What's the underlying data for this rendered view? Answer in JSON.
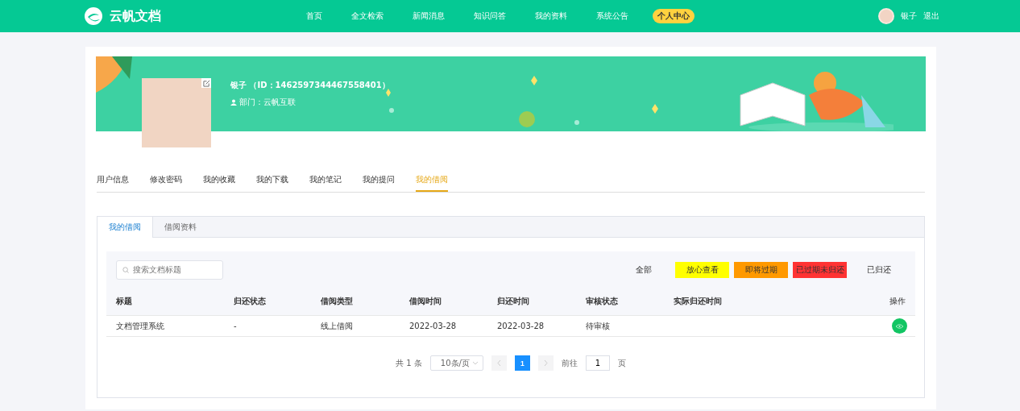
{
  "header": {
    "brand": "云帆文档",
    "nav": [
      {
        "label": "首页",
        "selected": false
      },
      {
        "label": "全文检索",
        "selected": false
      },
      {
        "label": "新闻消息",
        "selected": false
      },
      {
        "label": "知识问答",
        "selected": false
      },
      {
        "label": "我的资料",
        "selected": false
      },
      {
        "label": "系统公告",
        "selected": false
      },
      {
        "label": "个人中心",
        "selected": true
      }
    ],
    "user": "银子",
    "logout": "退出"
  },
  "profile": {
    "name": "银子 （ID：1462597344467558401）",
    "department": "部门：云帆互联"
  },
  "tabs": [
    {
      "label": "用户信息",
      "selected": false
    },
    {
      "label": "修改密码",
      "selected": false
    },
    {
      "label": "我的收藏",
      "selected": false
    },
    {
      "label": "我的下载",
      "selected": false
    },
    {
      "label": "我的笔记",
      "selected": false
    },
    {
      "label": "我的提问",
      "selected": false
    },
    {
      "label": "我的借阅",
      "selected": true
    }
  ],
  "subtabs": [
    {
      "label": "我的借阅",
      "selected": true
    },
    {
      "label": "借阅资料",
      "selected": false
    }
  ],
  "search": {
    "placeholder": "搜索文档标题"
  },
  "filters": [
    {
      "label": "全部"
    },
    {
      "label": "放心查看",
      "color": "#ffff00"
    },
    {
      "label": "即将过期",
      "color": "#ff9900"
    },
    {
      "label": "已过期未归还",
      "color": "#ff3333"
    },
    {
      "label": "已归还"
    }
  ],
  "table": {
    "columns": [
      "标题",
      "归还状态",
      "借阅类型",
      "借阅时间",
      "归还时间",
      "审核状态",
      "实际归还时间",
      "操作"
    ],
    "rows": [
      {
        "cells": [
          "文档管理系统",
          "-",
          "线上借阅",
          "2022-03-28",
          "2022-03-28",
          "待审核",
          ""
        ]
      }
    ]
  },
  "pagination": {
    "total": "共 1 条",
    "page_size": "10条/页",
    "pages": [
      {
        "label": "1",
        "selected": true
      }
    ],
    "goto": "前往",
    "goto_value": "1",
    "page_unit": "页"
  }
}
